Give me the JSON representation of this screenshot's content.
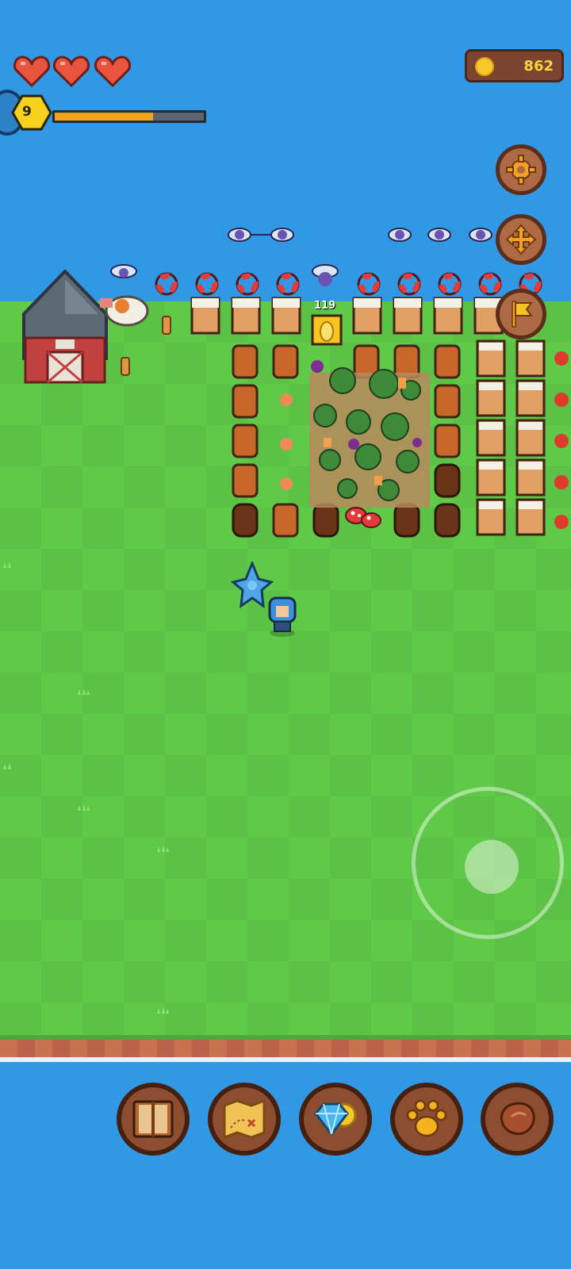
{
  "hud": {
    "hearts": {
      "filled": 3,
      "total": 3
    },
    "coins": "862",
    "level": "9",
    "xp_progress": 0.66,
    "icons": {
      "coin": "coin-icon",
      "settings": "gear-icon",
      "move": "move-arrows-icon",
      "flag": "flag-icon"
    }
  },
  "world": {
    "counter": "119",
    "objects": [
      "barn",
      "life-rings",
      "beehives",
      "tree-stumps",
      "goblin-crowd",
      "mushrooms",
      "player",
      "blue-dragon-pet"
    ]
  },
  "dock": [
    {
      "name": "book",
      "icon": "book-icon"
    },
    {
      "name": "map",
      "icon": "treasure-map-icon"
    },
    {
      "name": "shop",
      "icon": "diamond-coin-icon"
    },
    {
      "name": "pets",
      "icon": "paw-icon"
    },
    {
      "name": "meat",
      "icon": "meat-icon"
    }
  ],
  "colors": {
    "water": "#3198e6",
    "grass": "#5fc948",
    "panel": "#7a4430",
    "coin_text": "#f7d640",
    "xp_fill": "#f3a21c",
    "heart": "#e9543e"
  }
}
